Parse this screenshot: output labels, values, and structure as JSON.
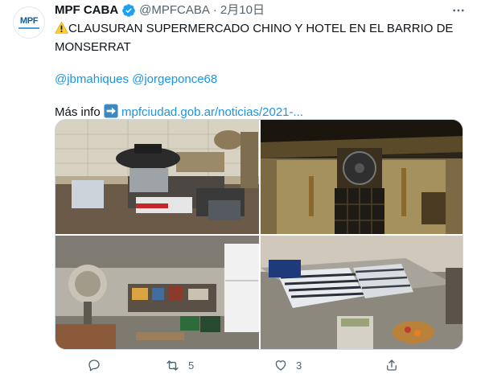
{
  "author": {
    "name": "MPF CABA",
    "handle": "@MPFCABA",
    "separator": "·",
    "date": "2月10日",
    "avatar_text": "MPF"
  },
  "tweet": {
    "line1": "CLAUSURAN SUPERMERCADO CHINO Y HOTEL EN EL BARRIO DE MONSERRAT",
    "mentions": "@jbmahiques @jorgeponce68",
    "more_info_label": "Más info",
    "link_text": "mpfciudad.gob.ar/noticias/2021-..."
  },
  "icons": {
    "warning": "warning-icon",
    "arrow": "right-arrow-icon",
    "verified": "verified-badge-icon",
    "more": "more-icon"
  },
  "media": {
    "photos": [
      {
        "name": "kitchen-stove-photo"
      },
      {
        "name": "greasy-exhaust-fan-photo"
      },
      {
        "name": "storage-room-photo"
      },
      {
        "name": "bedroom-clutter-photo"
      }
    ]
  },
  "actions": {
    "reply_count": "",
    "retweet_count": "5",
    "like_count": "3",
    "share_count": ""
  },
  "colors": {
    "link": "#1b95e0",
    "verified": "#1da1f2",
    "muted": "#536471"
  }
}
